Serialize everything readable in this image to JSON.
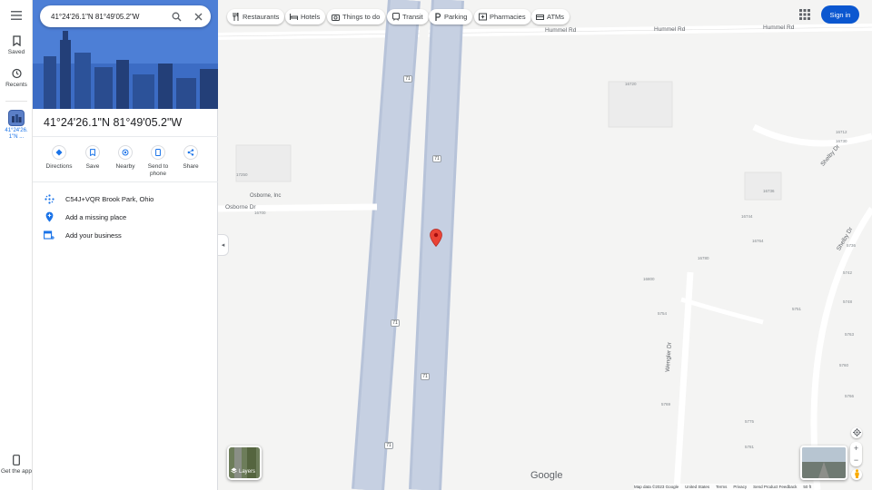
{
  "rail": {
    "saved": "Saved",
    "recents": "Recents",
    "recent_place": "41°24'26.1\"N ...",
    "get_app": "Get the app"
  },
  "search": {
    "value": "41°24'26.1\"N 81°49'05.2\"W"
  },
  "place": {
    "title": "41°24'26.1\"N 81°49'05.2\"W",
    "actions": [
      {
        "label": "Directions",
        "icon": "directions-icon"
      },
      {
        "label": "Save",
        "icon": "bookmark-icon"
      },
      {
        "label": "Nearby",
        "icon": "nearby-icon"
      },
      {
        "label": "Send to phone",
        "icon": "phone-icon"
      },
      {
        "label": "Share",
        "icon": "share-icon"
      }
    ],
    "plus_code": "C54J+VQR Brook Park, Ohio",
    "add_missing": "Add a missing place",
    "add_business": "Add your business"
  },
  "chips": [
    {
      "label": "Restaurants",
      "icon": "restaurant-icon"
    },
    {
      "label": "Hotels",
      "icon": "hotel-icon"
    },
    {
      "label": "Things to do",
      "icon": "camera-icon"
    },
    {
      "label": "Transit",
      "icon": "transit-icon"
    },
    {
      "label": "Parking",
      "icon": "parking-icon"
    },
    {
      "label": "Pharmacies",
      "icon": "pharmacy-icon"
    },
    {
      "label": "ATMs",
      "icon": "atm-icon"
    }
  ],
  "header": {
    "sign_in": "Sign in"
  },
  "map": {
    "layers_label": "Layers",
    "roads": {
      "hummel_1": "Hummel Rd",
      "hummel_2": "Hummel Rd",
      "hummel_3": "Hummel Rd",
      "shelby": "Shelby Dr",
      "shelby_2": "Shelby Dr",
      "osborne": "Osborne Dr",
      "wengler": "Wengler Dr"
    },
    "route_number": "71",
    "poi": "Osborne, Inc",
    "addresses": [
      "16720",
      "16712",
      "16730",
      "16736",
      "16744",
      "16750",
      "16764",
      "16780",
      "16800",
      "5736",
      "5742",
      "5748",
      "5751",
      "5754",
      "5760",
      "5763",
      "5766",
      "5769",
      "5775",
      "5781",
      "17250",
      "16700"
    ],
    "google": "Google",
    "footer": [
      "Map data ©2023 Google",
      "United States",
      "Terms",
      "Privacy",
      "Send Product Feedback",
      "50 ft"
    ]
  },
  "colors": {
    "accent": "#0b57d0",
    "link": "#1a73e8",
    "highway": "#b7c3d9",
    "pin": "#ea4335"
  }
}
